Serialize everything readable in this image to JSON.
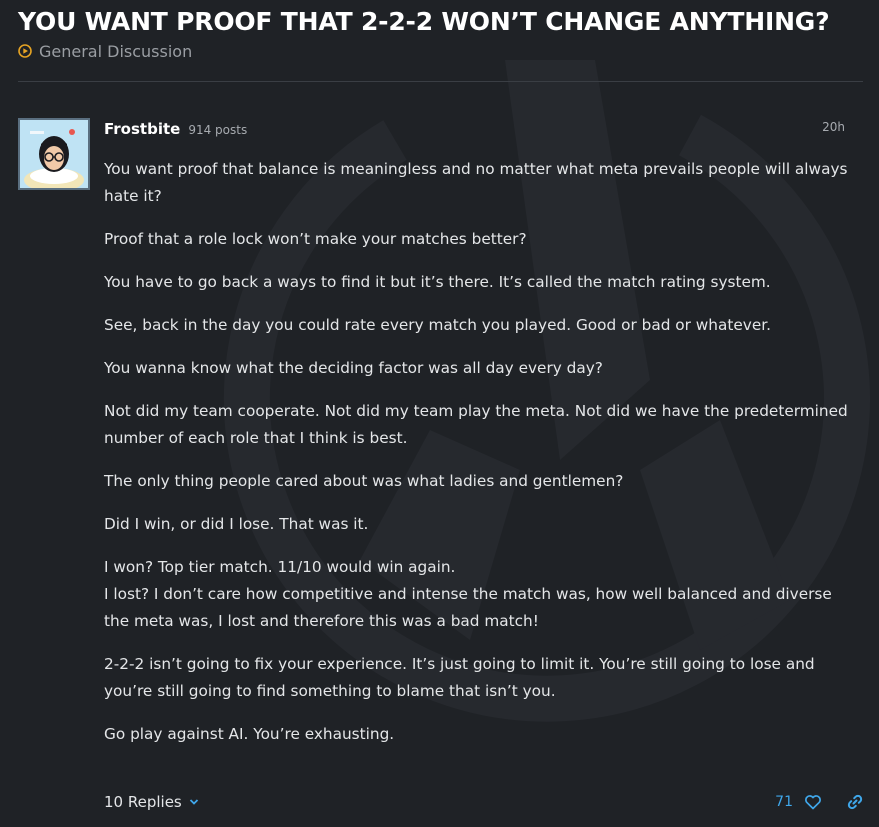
{
  "topic": {
    "title": "YOU WANT PROOF THAT 2-2-2 WON’T CHANGE ANYTHING?",
    "category": "General Discussion"
  },
  "post": {
    "username": "Frostbite",
    "post_count": "914 posts",
    "time": "20h",
    "paragraphs": [
      "You want proof that balance is meaningless and no matter what meta prevails people will always hate it?",
      "Proof that a role lock won’t make your matches better?",
      "You have to go back a ways to find it but it’s there. It’s called the match rating system.",
      "See, back in the day you could rate every match you played. Good or bad or whatever.",
      "You wanna know what the deciding factor was all day every day?",
      "Not did my team cooperate. Not did my team play the meta. Not did we have the predetermined number of each role that I think is best.",
      "The only thing people cared about was what ladies and gentlemen?",
      "Did I win, or did I lose. That was it.",
      "I won? Top tier match. 11/10 would win again.",
      "I lost? I don’t care how competitive and intense the match was, how well balanced and diverse the meta was, I lost and therefore this was a bad match!",
      "2-2-2 isn’t going to fix your experience. It’s just going to limit it. You’re still going to lose and you’re still going to find something to blame that isn’t you.",
      "Go play against AI. You’re exhausting."
    ],
    "replies_label": "10 Replies",
    "like_count": "71"
  },
  "icons": {
    "category": "category-play-icon",
    "replies": "chevron-down-icon",
    "like": "heart-icon",
    "share": "link-icon"
  },
  "colors": {
    "background": "#1f2226",
    "accent": "#3fa7ea",
    "category_icon": "#e5a323",
    "title": "#ffffff",
    "muted": "#9a9ea3"
  }
}
